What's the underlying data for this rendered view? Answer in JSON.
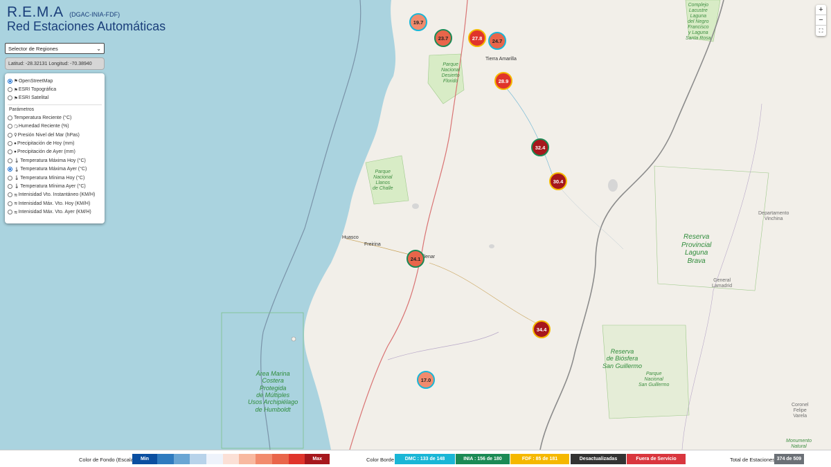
{
  "header": {
    "title": "R.E.M.A",
    "subtitle": "(DGAC-INIA-FDF)",
    "title_line2": "Red Estaciones Automáticas"
  },
  "controls": {
    "region_select": "Selector de Regiones",
    "coordinates": "Latitud: -28.32131 Longitud: -70.38940"
  },
  "base_layers": [
    {
      "label": "OpenStreetMap",
      "selected": true
    },
    {
      "label": "ESRI Topográfica",
      "selected": false
    },
    {
      "label": "ESRI Satelital",
      "selected": false
    }
  ],
  "parameters_title": "Parámetros",
  "parameters": [
    {
      "label": "Temperatura Reciente (°C)",
      "icon": "none",
      "selected": false
    },
    {
      "label": "Humedad Reciente (%)",
      "icon": "humidity-icon",
      "selected": false
    },
    {
      "label": "Presión Nivel del Mar (hPas)",
      "icon": "pressure-icon",
      "selected": false
    },
    {
      "label": "Precipitación de Hoy (mm)",
      "icon": "drop-icon",
      "selected": false
    },
    {
      "label": "Precipitación de Ayer (mm)",
      "icon": "drop-icon",
      "selected": false
    },
    {
      "label": "Temperatura Máxima Hoy (°C)",
      "icon": "thermometer-icon",
      "selected": false
    },
    {
      "label": "Temperatura Máxima Ayer (°C)",
      "icon": "thermometer-icon",
      "selected": true
    },
    {
      "label": "Temperatura Mínima Hoy (°C)",
      "icon": "thermometer-icon",
      "selected": false
    },
    {
      "label": "Temperatura Mínima Ayer (°C)",
      "icon": "thermometer-icon",
      "selected": false
    },
    {
      "label": "Intenisidad Vto. Instantáneo (KM/H)",
      "icon": "wind-icon",
      "selected": false
    },
    {
      "label": "Intenisidad Máx. Vto. Hoy (KM/H)",
      "icon": "wind-icon",
      "selected": false
    },
    {
      "label": "Intenisidad Máx. Vto. Ayer (KM/H)",
      "icon": "wind-icon",
      "selected": false
    }
  ],
  "zoom": {
    "in": "+",
    "out": "−",
    "fullscreen": "⛶"
  },
  "map_labels": {
    "chile_complex": "Complejo\nLacustre\nLaguna\ndel Negro\nFrancisco\ny Laguna\nSanta Rosa",
    "desierto_florido": "Parque\nNacional\nDesierto\nFlorido",
    "tierra_amarilla": "Tierra Amarilla",
    "llanos_challe": "Parque\nNacional\nLlanos\nde Challe",
    "huasco": "Huasco",
    "freirina": "Freirina",
    "vallenar": "llenar",
    "laguna_brava": "Reserva\nProvincial\nLaguna\nBrava",
    "vinchina": "Departamento\nVinchina",
    "lamadrid": "General\nLamadrid",
    "san_guillermo_reserva": "Reserva\nde Biósfera\nSan Guillermo",
    "san_guillermo_parque": "Parque\nNacional\nSan Guillermo",
    "humboldt": "Área Marina\nCostera\nProtegida\nde Múltiples\nUsos Archipiélago\nde Humboldt",
    "felipe_varela": "Coronel\nFelipe\nVarela",
    "monumento": "Monumento\nNatural"
  },
  "stations": [
    {
      "value": "19.7",
      "fill": "#f28b6d",
      "border": "#1ab6d6"
    },
    {
      "value": "23.7",
      "fill": "#e9654a",
      "border": "#1b8a55"
    },
    {
      "value": "27.8",
      "fill": "#e0342b",
      "border": "#f5b800"
    },
    {
      "value": "24.7",
      "fill": "#e9654a",
      "border": "#1ab6d6"
    },
    {
      "value": "28.9",
      "fill": "#e0342b",
      "border": "#f5b800"
    },
    {
      "value": "32.4",
      "fill": "#a6171c",
      "border": "#1b8a55"
    },
    {
      "value": "30.4",
      "fill": "#a6171c",
      "border": "#f5b800"
    },
    {
      "value": "24.1",
      "fill": "#e9654a",
      "border": "#1b8a55"
    },
    {
      "value": "34.4",
      "fill": "#a6171c",
      "border": "#f5b800"
    },
    {
      "value": "17.0",
      "fill": "#f28b6d",
      "border": "#1ab6d6"
    }
  ],
  "legend": {
    "background_label": "Color de Fondo (Escala)",
    "scale_min": "Min",
    "scale_max": "Max",
    "scale_colors": [
      "#0b4fa0",
      "#2f7bbf",
      "#6aa6d4",
      "#b8d3ea",
      "#eef3fb",
      "#fbe0d6",
      "#f8b9a0",
      "#f28b6d",
      "#e9654a",
      "#e0342b",
      "#a6171c"
    ],
    "border_label": "Color Borde",
    "dmc": "DMC : 133 de 148",
    "inia": "INIA : 156 de 180",
    "fdf": "FDF : 85 de 181",
    "outdated": "Desactualizadas",
    "out_of_service": "Fuera de Servicio",
    "total_label": "Total de Estaciones",
    "total_value": "374 de 509",
    "colors": {
      "dmc": "#1ab6d6",
      "inia": "#1b8a55",
      "fdf": "#f5b800",
      "outdated": "#333333",
      "out_of_service": "#d9363e"
    }
  }
}
